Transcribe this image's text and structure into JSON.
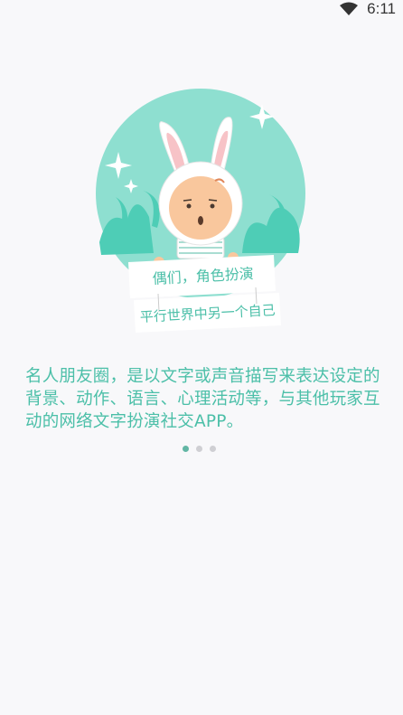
{
  "status_bar": {
    "time": "6:11",
    "wifi_icon": "wifi-icon"
  },
  "illustration": {
    "sign_line1": "偶们，角色扮演",
    "sign_line2": "平行世界中另一个自己",
    "colors": {
      "circle": "#8edfd0",
      "grass": "#4ecdb6",
      "face": "#f9c79d"
    }
  },
  "description": "名人朋友圈，是以文字或声音描写来表达设定的背景、动作、语言、心理活动等，与其他玩家互动的网络文字扮演社交APP。",
  "pager": {
    "total": 3,
    "current": 1
  },
  "colors": {
    "accent": "#4bbfa8",
    "background": "#f8f8fa"
  }
}
